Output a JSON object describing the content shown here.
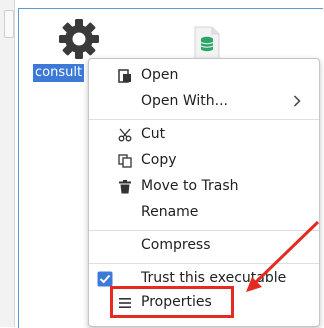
{
  "desktop": {
    "file_label": "consult",
    "accent_color": "#3d7ad8",
    "icons": [
      "gear-icon",
      "database-file-icon"
    ]
  },
  "context_menu": {
    "open": "Open",
    "open_with": "Open With...",
    "cut": "Cut",
    "copy": "Copy",
    "move_to_trash": "Move to Trash",
    "rename": "Rename",
    "compress": "Compress",
    "trust": "Trust this executable",
    "trust_checked": true,
    "properties": "Properties"
  },
  "annotation": {
    "color": "#e52a22"
  }
}
